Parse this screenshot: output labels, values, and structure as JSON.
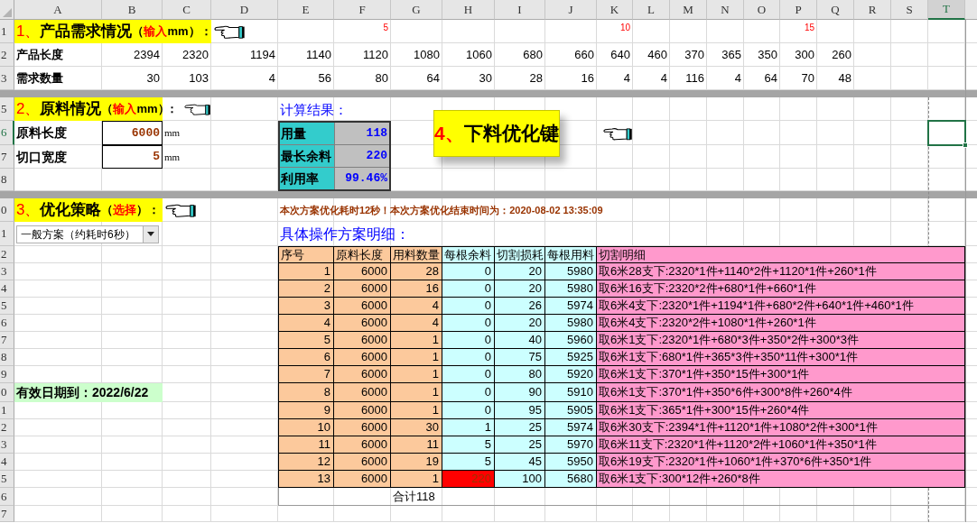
{
  "column_headers": [
    {
      "label": "A",
      "selected": false
    },
    {
      "label": "B",
      "selected": false
    },
    {
      "label": "C",
      "selected": false
    },
    {
      "label": "D",
      "selected": false
    },
    {
      "label": "E",
      "selected": false
    },
    {
      "label": "F",
      "selected": false
    },
    {
      "label": "G",
      "selected": false
    },
    {
      "label": "H",
      "selected": false
    },
    {
      "label": "I",
      "selected": false
    },
    {
      "label": "J",
      "selected": false
    },
    {
      "label": "K",
      "selected": false
    },
    {
      "label": "L",
      "selected": false
    },
    {
      "label": "M",
      "selected": false
    },
    {
      "label": "N",
      "selected": false
    },
    {
      "label": "O",
      "selected": false
    },
    {
      "label": "P",
      "selected": false
    },
    {
      "label": "Q",
      "selected": false
    },
    {
      "label": "R",
      "selected": false
    },
    {
      "label": "S",
      "selected": false
    },
    {
      "label": "T",
      "selected": true
    }
  ],
  "row_headers": [
    {
      "kind": "row",
      "label": "1",
      "selected": false
    },
    {
      "kind": "row",
      "label": "2",
      "selected": false
    },
    {
      "kind": "row",
      "label": "3",
      "selected": false
    },
    {
      "kind": "band",
      "selected": false
    },
    {
      "kind": "row",
      "label": "5",
      "selected": false
    },
    {
      "kind": "row",
      "label": "6",
      "selected": true
    },
    {
      "kind": "row",
      "label": "7",
      "selected": false
    },
    {
      "kind": "row",
      "label": "8",
      "selected": false
    },
    {
      "kind": "band",
      "selected": false
    },
    {
      "kind": "row",
      "label": "0",
      "selected": false
    },
    {
      "kind": "row",
      "label": "1",
      "selected": false
    },
    {
      "kind": "row",
      "label": "2",
      "selected": false
    },
    {
      "kind": "row",
      "label": "3",
      "selected": false
    },
    {
      "kind": "row",
      "label": "4",
      "selected": false
    },
    {
      "kind": "row",
      "label": "5",
      "selected": false
    },
    {
      "kind": "row",
      "label": "6",
      "selected": false
    },
    {
      "kind": "row",
      "label": "7",
      "selected": false
    },
    {
      "kind": "row",
      "label": "8",
      "selected": false
    },
    {
      "kind": "row",
      "label": "9",
      "selected": false
    },
    {
      "kind": "row",
      "label": "0",
      "selected": false
    },
    {
      "kind": "row",
      "label": "1",
      "selected": false
    },
    {
      "kind": "row",
      "label": "2",
      "selected": false
    },
    {
      "kind": "row",
      "label": "3",
      "selected": false
    },
    {
      "kind": "row",
      "label": "4",
      "selected": false
    },
    {
      "kind": "row",
      "label": "5",
      "selected": false
    },
    {
      "kind": "row",
      "label": "6",
      "selected": false
    },
    {
      "kind": "row",
      "label": "7",
      "selected": false
    }
  ],
  "product_demand": {
    "title": [
      {
        "kind": "number",
        "text": "1、"
      },
      {
        "kind": "main",
        "text": "产品需求情况"
      },
      {
        "kind": "aside",
        "text": "（"
      },
      {
        "kind": "accent",
        "text": "输入"
      },
      {
        "kind": "aside",
        "text": "mm）："
      }
    ],
    "row_labels": [
      "产品长度",
      "需求数量"
    ],
    "products": [
      {
        "length": "2394",
        "quantity": "30"
      },
      {
        "length": "2320",
        "quantity": "103"
      },
      {
        "length": "1194",
        "quantity": "4"
      },
      {
        "length": "1140",
        "quantity": "56"
      },
      {
        "length": "1120",
        "quantity": "80",
        "mark": "5"
      },
      {
        "length": "1080",
        "quantity": "64"
      },
      {
        "length": "1060",
        "quantity": "30"
      },
      {
        "length": "680",
        "quantity": "28"
      },
      {
        "length": "660",
        "quantity": "16"
      },
      {
        "length": "640",
        "quantity": "4",
        "mark": "10"
      },
      {
        "length": "460",
        "quantity": "4"
      },
      {
        "length": "370",
        "quantity": "116"
      },
      {
        "length": "365",
        "quantity": "4"
      },
      {
        "length": "350",
        "quantity": "64"
      },
      {
        "length": "300",
        "quantity": "70",
        "mark": "15"
      },
      {
        "length": "260",
        "quantity": "48"
      }
    ]
  },
  "material": {
    "title": [
      {
        "kind": "number",
        "text": "2、"
      },
      {
        "kind": "main",
        "text": "原料情况"
      },
      {
        "kind": "aside",
        "text": "（"
      },
      {
        "kind": "accent",
        "text": "输入"
      },
      {
        "kind": "aside",
        "text": "mm）"
      }
    ],
    "colon": "：",
    "fields": [
      {
        "label": "原料长度",
        "value": "6000",
        "unit": "mm"
      },
      {
        "label": "切口宽度",
        "value": "5",
        "unit": "mm"
      }
    ]
  },
  "results": {
    "title": "计算结果：",
    "items": [
      {
        "label": "用量",
        "value": "118"
      },
      {
        "label": "最长余料",
        "value": "220"
      },
      {
        "label": "利用率",
        "value": "99.46%"
      }
    ]
  },
  "optimize_button": [
    {
      "kind": "number",
      "text": "4、"
    },
    {
      "kind": "main",
      "text": "下料优化键"
    }
  ],
  "strategy": {
    "title": [
      {
        "kind": "number",
        "text": "3、"
      },
      {
        "kind": "main",
        "text": "优化策略"
      },
      {
        "kind": "aside",
        "text": "（"
      },
      {
        "kind": "accent",
        "text": "选择"
      },
      {
        "kind": "aside",
        "text": "）："
      }
    ],
    "dropdown": {
      "value": "一般方案（约耗时6秒）"
    }
  },
  "expiry": "有效日期到：2022/6/22",
  "status_message": "本次方案优化耗时12秒！本次方案优化结束时间为：2020-08-02  13:35:09",
  "plan_title": "具体操作方案明细：",
  "plan_table": {
    "columns": [
      "序号",
      "原料长度",
      "用料数量",
      "每根余料",
      "切割损耗",
      "每根用料",
      "切割明细"
    ],
    "rows": [
      {
        "cells": [
          "1",
          "6000",
          "28",
          "0",
          "20",
          "5980"
        ],
        "detail": "取6米28支下:2320*1件+1140*2件+1120*1件+260*1件",
        "warning": false
      },
      {
        "cells": [
          "2",
          "6000",
          "16",
          "0",
          "20",
          "5980"
        ],
        "detail": "取6米16支下:2320*2件+680*1件+660*1件",
        "warning": false
      },
      {
        "cells": [
          "3",
          "6000",
          "4",
          "0",
          "26",
          "5974"
        ],
        "detail": "取6米4支下:2320*1件+1194*1件+680*2件+640*1件+460*1件",
        "warning": false
      },
      {
        "cells": [
          "4",
          "6000",
          "4",
          "0",
          "20",
          "5980"
        ],
        "detail": "取6米4支下:2320*2件+1080*1件+260*1件",
        "warning": false
      },
      {
        "cells": [
          "5",
          "6000",
          "1",
          "0",
          "40",
          "5960"
        ],
        "detail": "取6米1支下:2320*1件+680*3件+350*2件+300*3件",
        "warning": false
      },
      {
        "cells": [
          "6",
          "6000",
          "1",
          "0",
          "75",
          "5925"
        ],
        "detail": "取6米1支下:680*1件+365*3件+350*11件+300*1件",
        "warning": false
      },
      {
        "cells": [
          "7",
          "6000",
          "1",
          "0",
          "80",
          "5920"
        ],
        "detail": "取6米1支下:370*1件+350*15件+300*1件",
        "warning": false
      },
      {
        "cells": [
          "8",
          "6000",
          "1",
          "0",
          "90",
          "5910"
        ],
        "detail": "取6米1支下:370*1件+350*6件+300*8件+260*4件",
        "warning": false
      },
      {
        "cells": [
          "9",
          "6000",
          "1",
          "0",
          "95",
          "5905"
        ],
        "detail": "取6米1支下:365*1件+300*15件+260*4件",
        "warning": false
      },
      {
        "cells": [
          "10",
          "6000",
          "30",
          "1",
          "25",
          "5974"
        ],
        "detail": "取6米30支下:2394*1件+1120*1件+1080*2件+300*1件",
        "warning": false
      },
      {
        "cells": [
          "11",
          "6000",
          "11",
          "5",
          "25",
          "5970"
        ],
        "detail": "取6米11支下:2320*1件+1120*2件+1060*1件+350*1件",
        "warning": false
      },
      {
        "cells": [
          "12",
          "6000",
          "19",
          "5",
          "45",
          "5950"
        ],
        "detail": "取6米19支下:2320*1件+1060*1件+370*6件+350*1件",
        "warning": false
      },
      {
        "cells": [
          "13",
          "6000",
          "1",
          "220",
          "100",
          "5680"
        ],
        "detail": "取6米1支下:300*12件+260*8件",
        "warning": true
      }
    ],
    "total": "合计118"
  }
}
